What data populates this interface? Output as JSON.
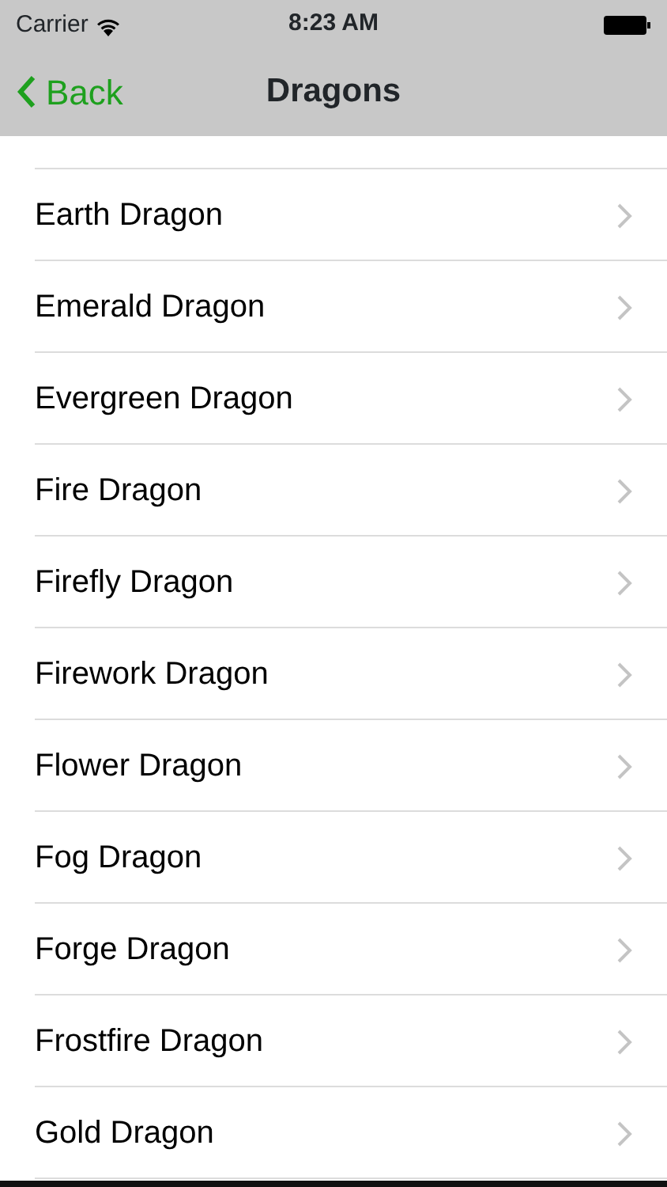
{
  "status_bar": {
    "carrier": "Carrier",
    "time": "8:23 AM"
  },
  "nav_bar": {
    "back": "Back",
    "title": "Dragons"
  },
  "rows": [
    {
      "label": "Earth Dragon"
    },
    {
      "label": "Emerald Dragon"
    },
    {
      "label": "Evergreen Dragon"
    },
    {
      "label": "Fire Dragon"
    },
    {
      "label": "Firefly Dragon"
    },
    {
      "label": "Firework Dragon"
    },
    {
      "label": "Flower Dragon"
    },
    {
      "label": "Fog Dragon"
    },
    {
      "label": "Forge Dragon"
    },
    {
      "label": "Frostfire Dragon"
    },
    {
      "label": "Gold Dragon"
    }
  ]
}
